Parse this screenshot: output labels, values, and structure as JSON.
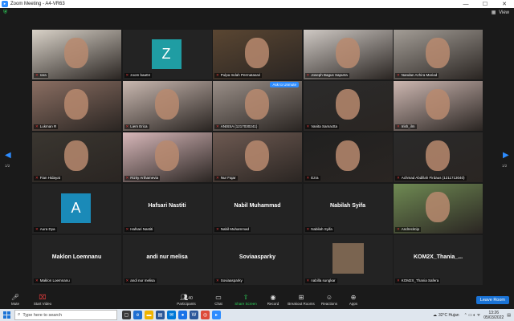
{
  "window": {
    "title": "Zoom Meeting - A4-VR63",
    "minimize": "—",
    "maximize": "☐",
    "close": "✕"
  },
  "view": {
    "label": "View",
    "icon": "grid-icon"
  },
  "pagination": {
    "left": "1/2",
    "right": "1/2"
  },
  "tiles": [
    {
      "name": "rara",
      "type": "video",
      "bg": "#d9d2c8",
      "active": true
    },
    {
      "name": "zoom baa04",
      "type": "avatar",
      "initial": "Z",
      "avcolor": "#1f9da3"
    },
    {
      "name": "Pulpa Indah Permatasari",
      "type": "video",
      "bg": "#5a4632"
    },
    {
      "name": "Joseph Bagus Saputra",
      "type": "video",
      "bg": "#cfc9c4"
    },
    {
      "name": "Nandan Azhira Mariad",
      "type": "video",
      "bg": "#a39d96"
    },
    {
      "name": "Lukman R",
      "type": "video",
      "bg": "#8a6e62"
    },
    {
      "name": "Liem Erica",
      "type": "video",
      "bg": "#c9b8b0"
    },
    {
      "name": "ANISSA (1217030241)",
      "type": "video",
      "bg": "#9a8f88",
      "unmute": "Ask to Unmute"
    },
    {
      "name": "Vanita Samactta",
      "type": "video",
      "bg": "#2b2b2b"
    },
    {
      "name": "Irish_ilm",
      "type": "video",
      "bg": "#cdb7b1"
    },
    {
      "name": "Fian Hidayat",
      "type": "video",
      "bg": "#3a3630"
    },
    {
      "name": "Rizky Arthamevia",
      "type": "video",
      "bg": "#d7b7b9"
    },
    {
      "name": "Nur Fajar",
      "type": "video",
      "bg": "#6e5a52"
    },
    {
      "name": "Ezra",
      "type": "video",
      "bg": "#202020"
    },
    {
      "name": "Achmad Abdillah Firdaus (1211713040)",
      "type": "video",
      "bg": "#2a2a2a"
    },
    {
      "name": "Aura Dya",
      "type": "avatar",
      "initial": "A",
      "avcolor": "#1a8ab8"
    },
    {
      "name": "Hafsari Nastiti",
      "type": "name",
      "big": "Hafsari Nastiti"
    },
    {
      "name": "Nabil Muhammad",
      "type": "name",
      "big": "Nabil Muhammad"
    },
    {
      "name": "Nabilah Syifa",
      "type": "name",
      "big": "Nabilah Syifa"
    },
    {
      "name": "Andrecitcip",
      "type": "video",
      "bg": "#6f8a53"
    },
    {
      "name": "Maklon Loemnanu",
      "type": "name",
      "big": "Maklon Loemnanu"
    },
    {
      "name": "andi nur melisa",
      "type": "name",
      "big": "andi nur melisa"
    },
    {
      "name": "Soviaasparky",
      "type": "name",
      "big": "Soviaasparky"
    },
    {
      "name": "nabilla sungkar",
      "type": "thumb",
      "bg": "#7a6450"
    },
    {
      "name": "KOM2X_Thania Safera",
      "type": "name",
      "big": "KOM2X_Thania_..."
    }
  ],
  "toolbar": {
    "mute": "Mute",
    "start_video": "Start Video",
    "participants": "Participants",
    "participants_count": "40",
    "chat": "Chat",
    "share": "Share Screen",
    "record": "Record",
    "breakout": "Breakout Rooms",
    "reactions": "Reactions",
    "apps": "Apps",
    "leave": "Leave Room"
  },
  "taskbar": {
    "search_placeholder": "Type here to search",
    "weather": "32°C  Hujan",
    "time": "13:26",
    "date": "05/03/2022"
  },
  "colors": {
    "accent": "#2d8cff",
    "active_border": "#c9ea4a",
    "muted_red": "#e03c3c",
    "share_green": "#2ed35a"
  }
}
